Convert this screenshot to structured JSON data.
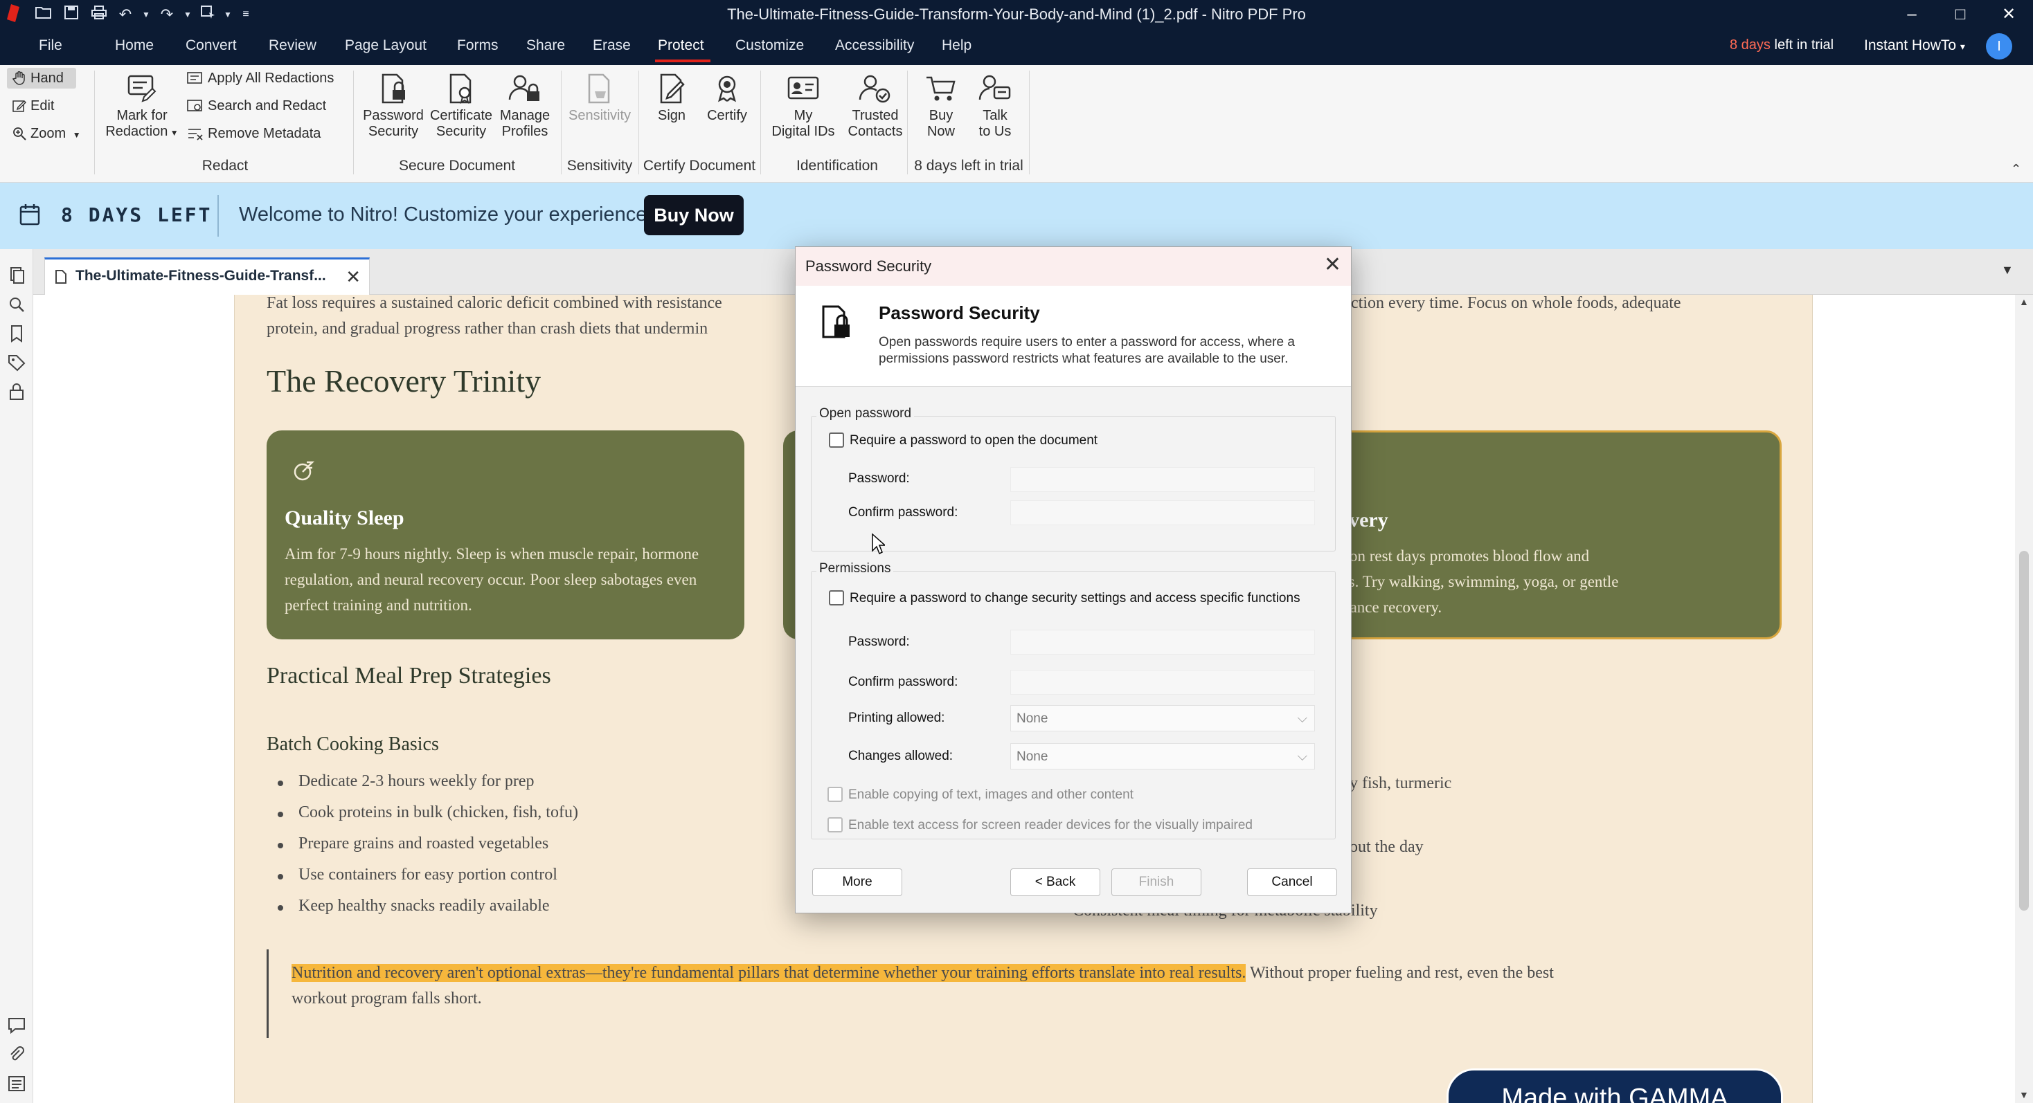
{
  "window": {
    "title": "The-Ultimate-Fitness-Guide-Transform-Your-Body-and-Mind (1)_2.pdf - Nitro PDF Pro",
    "minimize": "–",
    "maximize": "□",
    "close": "✕"
  },
  "menu": {
    "items": [
      "File",
      "Home",
      "Convert",
      "Review",
      "Page Layout",
      "Forms",
      "Share",
      "Erase",
      "Protect",
      "Customize",
      "Accessibility",
      "Help"
    ],
    "active": "Protect",
    "trial_days": "8 days",
    "trial_suffix": "left in trial",
    "user": "Instant HowTo",
    "user_chevron": "▾",
    "avatar_initial": "I"
  },
  "ribbon": {
    "nav": {
      "hand": "Hand",
      "edit": "Edit",
      "zoom": "Zoom"
    },
    "redact": {
      "mark": "Mark for",
      "mark2": "Redaction",
      "apply": "Apply All Redactions",
      "search": "Search and Redact",
      "remove": "Remove Metadata",
      "group": "Redact"
    },
    "secure": {
      "password": "Password",
      "password2": "Security",
      "certificate": "Certificate",
      "certificate2": "Security",
      "manage": "Manage",
      "manage2": "Profiles",
      "group": "Secure Document"
    },
    "sensitivity": {
      "label": "Sensitivity",
      "group": "Sensitivity"
    },
    "certify": {
      "sign": "Sign",
      "certify": "Certify",
      "group": "Certify Document"
    },
    "identification": {
      "my": "My",
      "my2": "Digital IDs",
      "trusted": "Trusted",
      "trusted2": "Contacts",
      "group": "Identification"
    },
    "trial": {
      "buy": "Buy",
      "buy2": "Now",
      "talk": "Talk",
      "talk2": "to Us",
      "group": "8 days left in trial"
    }
  },
  "banner": {
    "days_left": "8 DAYS LEFT",
    "welcome": "Welcome to Nitro! Customize your experience.",
    "buy_now": "Buy Now"
  },
  "tab": {
    "label": "The-Ultimate-Fitness-Guide-Transf...",
    "close": "✕"
  },
  "document": {
    "intro_line1": "Fat loss requires a sustained caloric deficit combined with resistance",
    "intro_line1_right": "ction every time. Focus on whole foods, adequate",
    "intro_line2": "protein, and gradual progress rather than crash diets that undermin",
    "recovery_title": "The Recovery Trinity",
    "card1": {
      "title": "Quality Sleep",
      "body": "Aim for 7-9 hours nightly. Sleep is when muscle repair, hormone regulation, and neural recovery occur. Poor sleep sabotages even perfect training and nutrition."
    },
    "card3": {
      "title": "e Recovery",
      "line1": "ovement on rest days promotes blood flow and",
      "line2": "s soreness. Try walking, swimming, yoga, or gentle",
      "line3": "ng to enhance recovery."
    },
    "meal_title": "Practical Meal Prep Strategies",
    "batch_title": "Batch Cooking Basics",
    "batch_items": [
      "Dedicate 2-3 hours weekly for prep",
      "Cook proteins in bulk (chicken, fish, tofu)",
      "Prepare grains and roasted vegetables",
      "Use containers for easy portion control",
      "Keep healthy snacks readily available"
    ],
    "right_fragment1": "y fish, turmeric",
    "right_fragment2": "out the day",
    "right_fragment3": "Consistent meal timing for metabolic stability",
    "quote_highlight": "Nutrition and recovery aren't optional extras—they're fundamental pillars that determine whether your training efforts translate into real results.",
    "quote_rest": " Without proper fueling and rest, even the best",
    "quote_line2": "workout program falls short.",
    "made_with": "Made with GAMMA"
  },
  "dialog": {
    "title": "Password Security",
    "close": "✕",
    "heading": "Password Security",
    "description": "Open passwords require users to enter a password for access, where a permissions password restricts what features are available to the user.",
    "open_password": {
      "legend": "Open password",
      "require": "Require a password to open the document",
      "password_label": "Password:",
      "confirm_label": "Confirm password:"
    },
    "permissions": {
      "legend": "Permissions",
      "require": "Require a password to change security settings and access specific functions",
      "password_label": "Password:",
      "confirm_label": "Confirm password:",
      "printing_label": "Printing allowed:",
      "printing_value": "None",
      "changes_label": "Changes allowed:",
      "changes_value": "None",
      "copy_option": "Enable copying of text, images and other content",
      "reader_option": "Enable text access for screen reader devices for the visually impaired"
    },
    "buttons": {
      "more": "More",
      "back": "< Back",
      "finish": "Finish",
      "cancel": "Cancel"
    }
  },
  "colors": {
    "titlebar": "#0c1b33",
    "accent_red": "#e2231a",
    "banner": "#c3e6fb",
    "card_green": "#6b7445",
    "highlight": "#f6b73c"
  }
}
